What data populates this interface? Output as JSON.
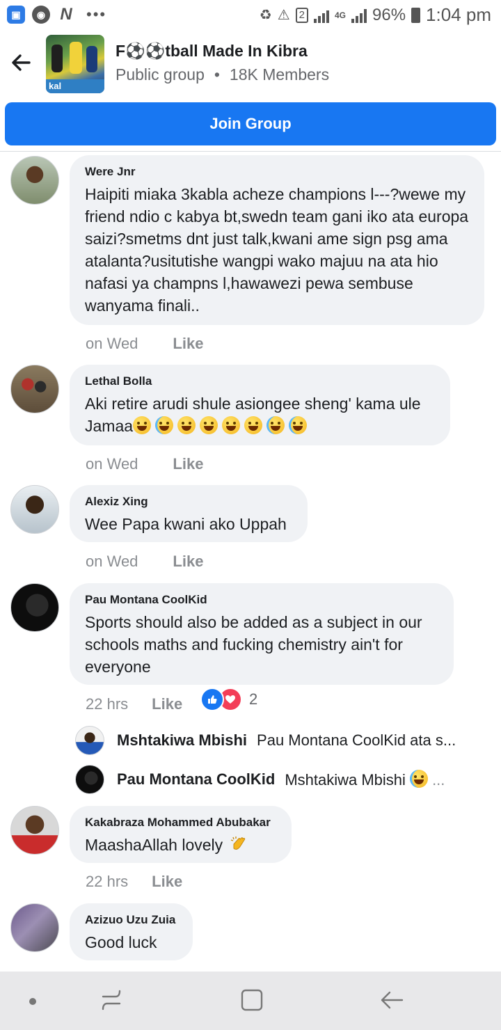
{
  "status_bar": {
    "network": "4G",
    "sim_slot": "2",
    "battery": "96%",
    "time": "1:04 pm",
    "more": "•••",
    "icons": [
      "screenshot-icon",
      "chrome-icon",
      "netflix-icon",
      "recycle-icon",
      "alert-icon",
      "signal-icon",
      "battery-icon"
    ]
  },
  "group": {
    "title": "F⚽⚽tball Made In Kibra",
    "privacy": "Public group",
    "separator": "•",
    "members": "18K Members",
    "cover_text": "kal"
  },
  "join_button": "Join Group",
  "comments": [
    {
      "author": "Were Jnr",
      "text": "Haipiti miaka 3kabla acheze champions l---?wewe my friend ndio c kabya bt,swedn team gani iko ata europa saizi?smetms dnt just talk,kwani ame sign psg ama atalanta?usitutishe wangpi wako majuu na ata hio nafasi ya champns l,hawawezi pewa sembuse wanyama finali..",
      "time": "on Wed",
      "like": "Like"
    },
    {
      "author": "Lethal Bolla",
      "text_line1": "Aki retire arudi shule asiongee sheng' kama ule",
      "text_line2": "Jamaa",
      "time": "on Wed",
      "like": "Like"
    },
    {
      "author": "Alexiz Xing",
      "text": "Wee Papa kwani ako Uppah",
      "time": "on Wed",
      "like": "Like"
    },
    {
      "author": "Pau Montana CoolKid",
      "text": "Sports should also be added as a subject in our schools maths and fucking chemistry ain't for everyone",
      "time": "22 hrs",
      "like": "Like",
      "reaction_count": "2"
    },
    {
      "author": "Kakabraza Mohammed Abubakar",
      "text": "MaashaAllah lovely",
      "time": "22 hrs",
      "like": "Like"
    },
    {
      "author": "Azizuo Uzu Zuia",
      "text": "Good luck"
    }
  ],
  "replies": [
    {
      "author": "Mshtakiwa Mbishi",
      "text": "Pau Montana CoolKid ata s..."
    },
    {
      "author": "Pau Montana CoolKid",
      "text": "Mshtakiwa Mbishi"
    }
  ],
  "colors": {
    "accent": "#1877f2",
    "bubble": "#f0f2f5",
    "muted": "#65676b",
    "love": "#f33e58"
  }
}
